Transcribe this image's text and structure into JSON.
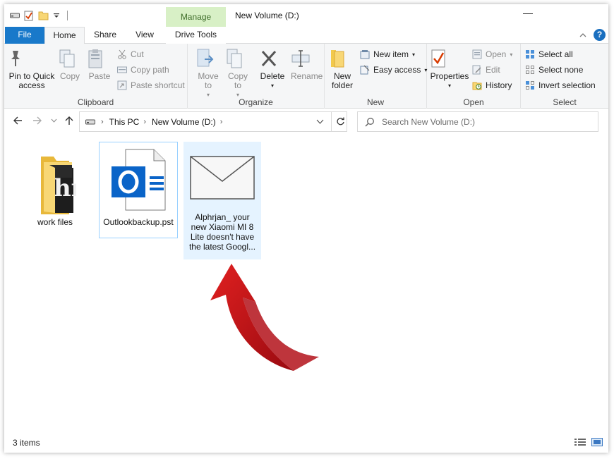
{
  "titlebar": {
    "manage_label": "Manage",
    "window_title": "New Volume (D:)",
    "minimize_glyph": "—"
  },
  "tabs": {
    "file": "File",
    "home": "Home",
    "share": "Share",
    "view": "View",
    "drive_tools": "Drive Tools",
    "help": "?"
  },
  "ribbon": {
    "clipboard": {
      "pin": "Pin to Quick access",
      "copy": "Copy",
      "paste": "Paste",
      "cut": "Cut",
      "copy_path": "Copy path",
      "paste_shortcut": "Paste shortcut",
      "label": "Clipboard"
    },
    "organize": {
      "move_to": "Move to",
      "copy_to": "Copy to",
      "delete": "Delete",
      "rename": "Rename",
      "label": "Organize"
    },
    "new": {
      "new_folder": "New folder",
      "new_item": "New item",
      "easy_access": "Easy access",
      "label": "New"
    },
    "open": {
      "properties": "Properties",
      "open": "Open",
      "edit": "Edit",
      "history": "History",
      "label": "Open"
    },
    "select": {
      "select_all": "Select all",
      "select_none": "Select none",
      "invert_selection": "Invert selection",
      "label": "Select"
    }
  },
  "address": {
    "crumbs": [
      "This PC",
      "New Volume (D:)"
    ],
    "search_placeholder": "Search New Volume (D:)"
  },
  "files": [
    {
      "name": "work files",
      "icon": "folder-icon"
    },
    {
      "name": "Outlookbackup.pst",
      "icon": "outlook-pst-icon"
    },
    {
      "name": "Alphrjan_ your new Xiaomi MI 8 Lite doesn't have the latest Googl...",
      "icon": "email-envelope-icon"
    }
  ],
  "status": {
    "item_count": "3 items"
  },
  "colors": {
    "file_tab": "#1979ca",
    "manage_tab": "#d8f0c6",
    "selection_fill": "#e5f3ff",
    "selection_border": "#99d1ff",
    "arrow": "#c8101a",
    "outlook_blue": "#0a64c8"
  }
}
